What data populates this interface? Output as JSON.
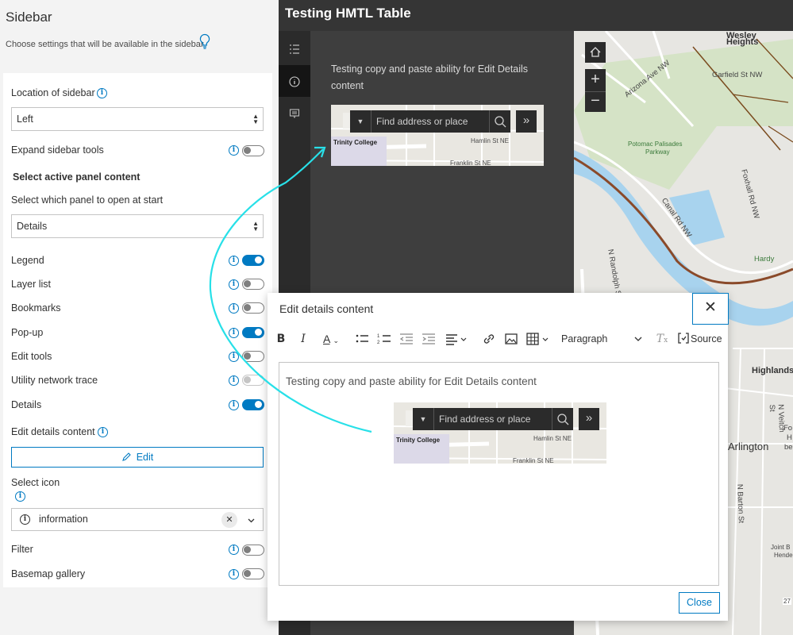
{
  "settings": {
    "title": "Sidebar",
    "description": "Choose settings that will be available in the sidebar",
    "location_label": "Location of sidebar",
    "location_value": "Left",
    "expand_label": "Expand sidebar tools",
    "section_heading": "Select active panel content",
    "panel_start_label": "Select which panel to open at start",
    "panel_start_value": "Details",
    "toggles": [
      {
        "label": "Legend",
        "on": true
      },
      {
        "label": "Layer list",
        "on": false
      },
      {
        "label": "Bookmarks",
        "on": false
      },
      {
        "label": "Pop-up",
        "on": true
      },
      {
        "label": "Edit tools",
        "on": false
      },
      {
        "label": "Utility network trace",
        "on": false
      },
      {
        "label": "Details",
        "on": true
      }
    ],
    "edit_details_label": "Edit details content",
    "edit_button": "Edit",
    "select_icon_label": "Select icon",
    "icon_value": "information",
    "filter_label": "Filter",
    "basemap_label": "Basemap gallery"
  },
  "app": {
    "title": "Testing HMTL Table",
    "panel_text": "Testing copy and paste ability for Edit Details content",
    "search_placeholder": "Find address or place",
    "mini_map_labels": {
      "place": "Trinity College",
      "street1": "Hamlin St NE",
      "street2": "Franklin St NE"
    },
    "map_labels": {
      "wesley": "Wesley",
      "heights": "Heights",
      "garfield": "Garfield St NW",
      "arizona": "Arizona Ave NW",
      "potomac": "Potomac Palisades",
      "parkway": "Parkway",
      "foxhall": "Foxhall Rd NW",
      "canal": "Canal Rd NW",
      "hardy": "Hardy",
      "highlands": "Highlands",
      "arlington": "Arlington",
      "veitch": "N Veitch St",
      "barton": "N Barton St",
      "randolph": "N Randolph St",
      "joint": "Joint B",
      "hende": "Hende",
      "fo": "Fo",
      "h": "H",
      "ber": "ber",
      "num": "27"
    }
  },
  "modal": {
    "title": "Edit details content",
    "format_value": "Paragraph",
    "source_label": "Source",
    "content_text": "Testing copy and paste ability for Edit Details content",
    "close_button": "Close"
  },
  "colors": {
    "accent": "#007ac2",
    "annotation": "#28e0e8"
  }
}
